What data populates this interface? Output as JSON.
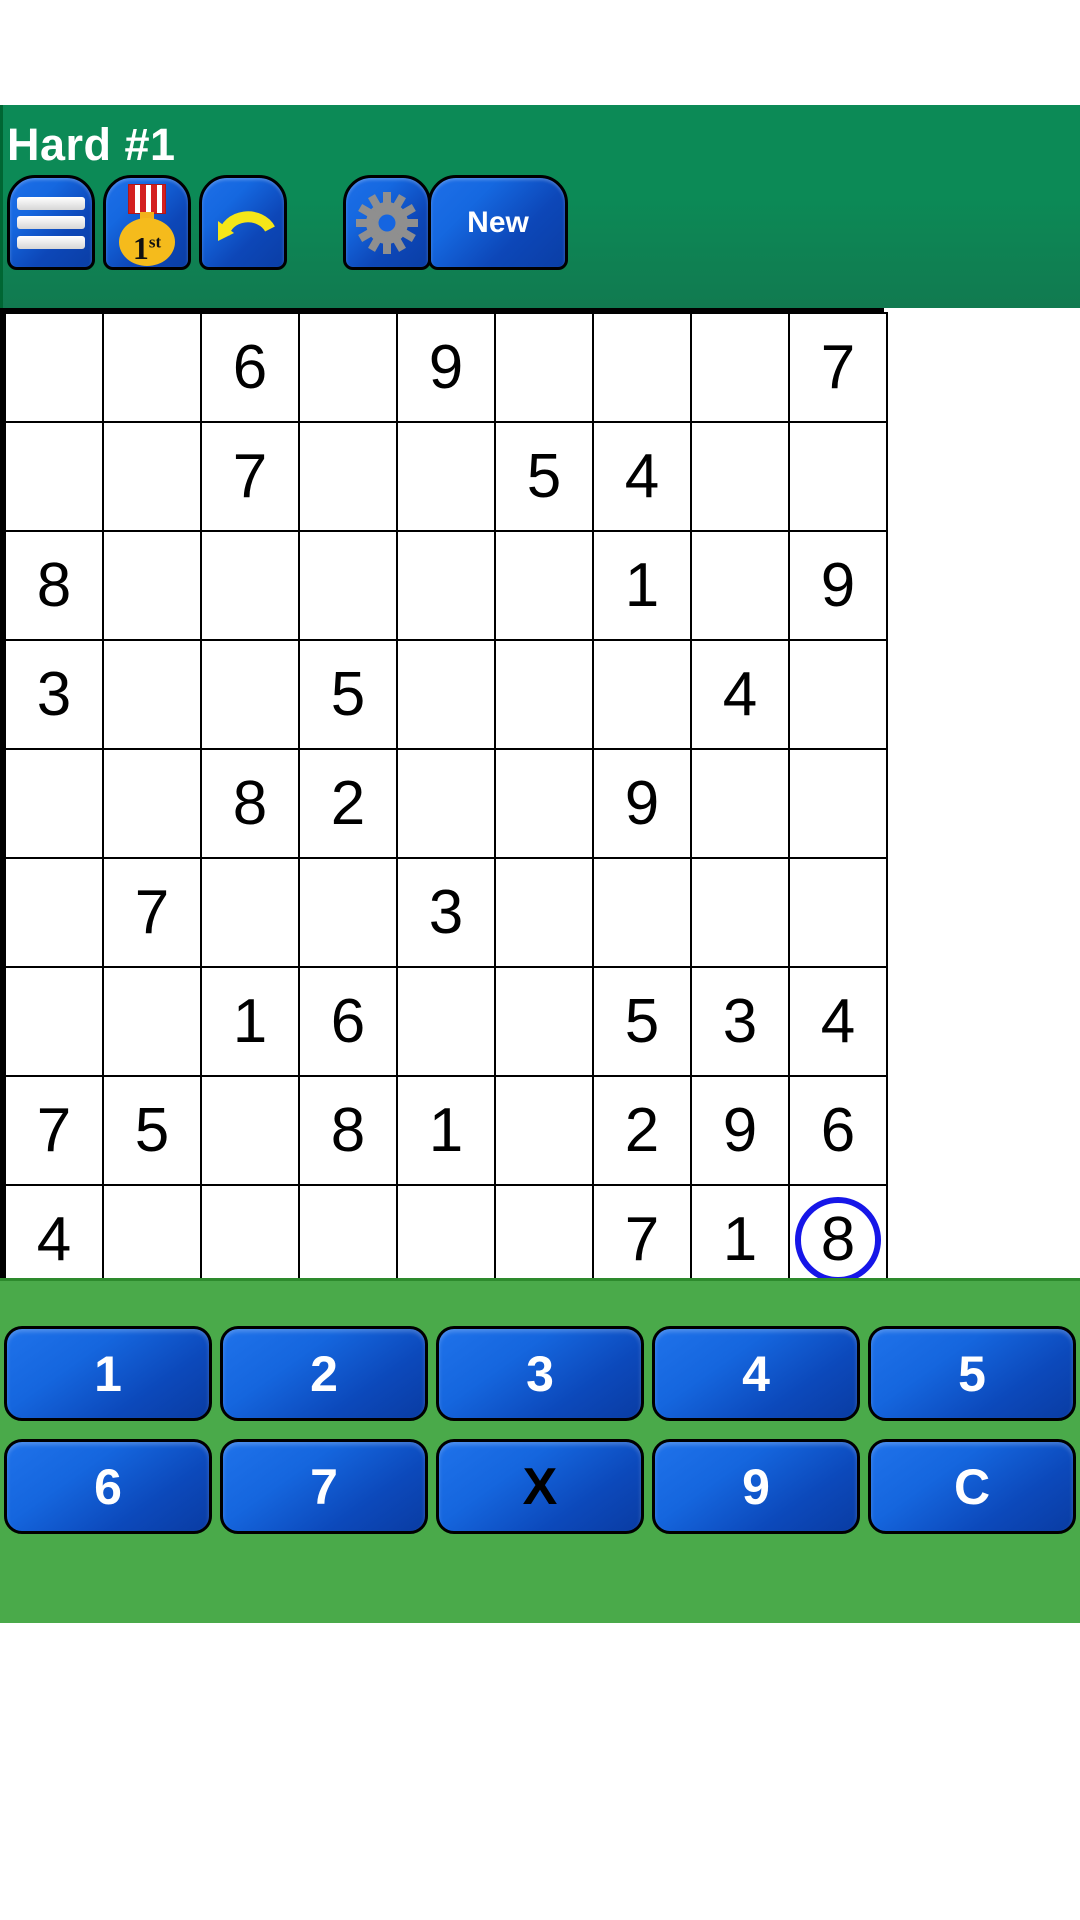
{
  "header": {
    "title": "Hard #1",
    "background_color": "#0c8a56",
    "buttons": [
      {
        "name": "menu-button",
        "icon": "hamburger-menu-icon",
        "label": ""
      },
      {
        "name": "trophy-button",
        "icon": "first-place-medal-icon",
        "label": "",
        "medal_text": "1",
        "medal_suffix": "st"
      },
      {
        "name": "undo-button",
        "icon": "undo-arrow-icon",
        "label": ""
      },
      {
        "name": "settings-button",
        "icon": "gear-icon",
        "label": ""
      },
      {
        "name": "new-game-button",
        "icon": "",
        "label": "New"
      }
    ]
  },
  "board": {
    "given_cell_color": "#e2e2e2",
    "empty_cell_color": "#ffffff",
    "user_value_color": "#1616e8",
    "given_value_color": "#000000",
    "selected_cell_color": "#9bf09b",
    "selected_cell": {
      "row": 9,
      "col": 9
    },
    "rows": [
      [
        {
          "v": "",
          "t": "empty"
        },
        {
          "v": "",
          "t": "empty"
        },
        {
          "v": "6",
          "t": "given"
        },
        {
          "v": "",
          "t": "empty"
        },
        {
          "v": "9",
          "t": "given"
        },
        {
          "v": "",
          "t": "empty"
        },
        {
          "v": "",
          "t": "empty"
        },
        {
          "v": "",
          "t": "empty"
        },
        {
          "v": "7",
          "t": "given"
        }
      ],
      [
        {
          "v": "",
          "t": "empty"
        },
        {
          "v": "",
          "t": "empty"
        },
        {
          "v": "7",
          "t": "given"
        },
        {
          "v": "",
          "t": "empty"
        },
        {
          "v": "",
          "t": "empty"
        },
        {
          "v": "5",
          "t": "given"
        },
        {
          "v": "4",
          "t": "given"
        },
        {
          "v": "",
          "t": "empty"
        },
        {
          "v": "",
          "t": "empty"
        }
      ],
      [
        {
          "v": "8",
          "t": "given"
        },
        {
          "v": "",
          "t": "empty"
        },
        {
          "v": "",
          "t": "empty"
        },
        {
          "v": "",
          "t": "empty"
        },
        {
          "v": "",
          "t": "empty"
        },
        {
          "v": "",
          "t": "empty"
        },
        {
          "v": "1",
          "t": "given"
        },
        {
          "v": "",
          "t": "empty"
        },
        {
          "v": "9",
          "t": "given"
        }
      ],
      [
        {
          "v": "3",
          "t": "given"
        },
        {
          "v": "",
          "t": "empty"
        },
        {
          "v": "",
          "t": "empty"
        },
        {
          "v": "5",
          "t": "given"
        },
        {
          "v": "",
          "t": "empty"
        },
        {
          "v": "",
          "t": "empty"
        },
        {
          "v": "",
          "t": "empty"
        },
        {
          "v": "4",
          "t": "given"
        },
        {
          "v": "",
          "t": "empty"
        }
      ],
      [
        {
          "v": "",
          "t": "empty"
        },
        {
          "v": "",
          "t": "empty"
        },
        {
          "v": "8",
          "t": "given"
        },
        {
          "v": "2",
          "t": "given"
        },
        {
          "v": "",
          "t": "empty"
        },
        {
          "v": "",
          "t": "empty"
        },
        {
          "v": "9",
          "t": "given"
        },
        {
          "v": "",
          "t": "empty"
        },
        {
          "v": "",
          "t": "empty"
        }
      ],
      [
        {
          "v": "",
          "t": "empty"
        },
        {
          "v": "7",
          "t": "given"
        },
        {
          "v": "",
          "t": "empty"
        },
        {
          "v": "",
          "t": "empty"
        },
        {
          "v": "3",
          "t": "given"
        },
        {
          "v": "",
          "t": "empty"
        },
        {
          "v": "",
          "t": "empty"
        },
        {
          "v": "",
          "t": "empty"
        },
        {
          "v": "",
          "t": "empty"
        }
      ],
      [
        {
          "v": "",
          "t": "empty"
        },
        {
          "v": "",
          "t": "empty"
        },
        {
          "v": "1",
          "t": "given"
        },
        {
          "v": "6",
          "t": "given"
        },
        {
          "v": "",
          "t": "empty"
        },
        {
          "v": "",
          "t": "empty"
        },
        {
          "v": "5",
          "t": "given"
        },
        {
          "v": "3",
          "t": "given"
        },
        {
          "v": "4",
          "t": "user"
        }
      ],
      [
        {
          "v": "7",
          "t": "given"
        },
        {
          "v": "5",
          "t": "given"
        },
        {
          "v": "",
          "t": "empty"
        },
        {
          "v": "8",
          "t": "given"
        },
        {
          "v": "1",
          "t": "given"
        },
        {
          "v": "",
          "t": "empty"
        },
        {
          "v": "2",
          "t": "user"
        },
        {
          "v": "9",
          "t": "given"
        },
        {
          "v": "6",
          "t": "given"
        }
      ],
      [
        {
          "v": "4",
          "t": "given"
        },
        {
          "v": "",
          "t": "empty"
        },
        {
          "v": "",
          "t": "empty"
        },
        {
          "v": "",
          "t": "empty"
        },
        {
          "v": "",
          "t": "empty"
        },
        {
          "v": "",
          "t": "empty"
        },
        {
          "v": "7",
          "t": "user"
        },
        {
          "v": "1",
          "t": "given"
        },
        {
          "v": "8",
          "t": "selected"
        }
      ]
    ]
  },
  "keypad": {
    "background_color": "#4aaa4a",
    "row1": [
      {
        "name": "key-1",
        "label": "1"
      },
      {
        "name": "key-2",
        "label": "2"
      },
      {
        "name": "key-3",
        "label": "3"
      },
      {
        "name": "key-4",
        "label": "4"
      },
      {
        "name": "key-5",
        "label": "5"
      }
    ],
    "row2": [
      {
        "name": "key-6",
        "label": "6"
      },
      {
        "name": "key-7",
        "label": "7"
      },
      {
        "name": "key-erase",
        "label": "X"
      },
      {
        "name": "key-9",
        "label": "9"
      },
      {
        "name": "key-clear",
        "label": "C"
      }
    ]
  }
}
